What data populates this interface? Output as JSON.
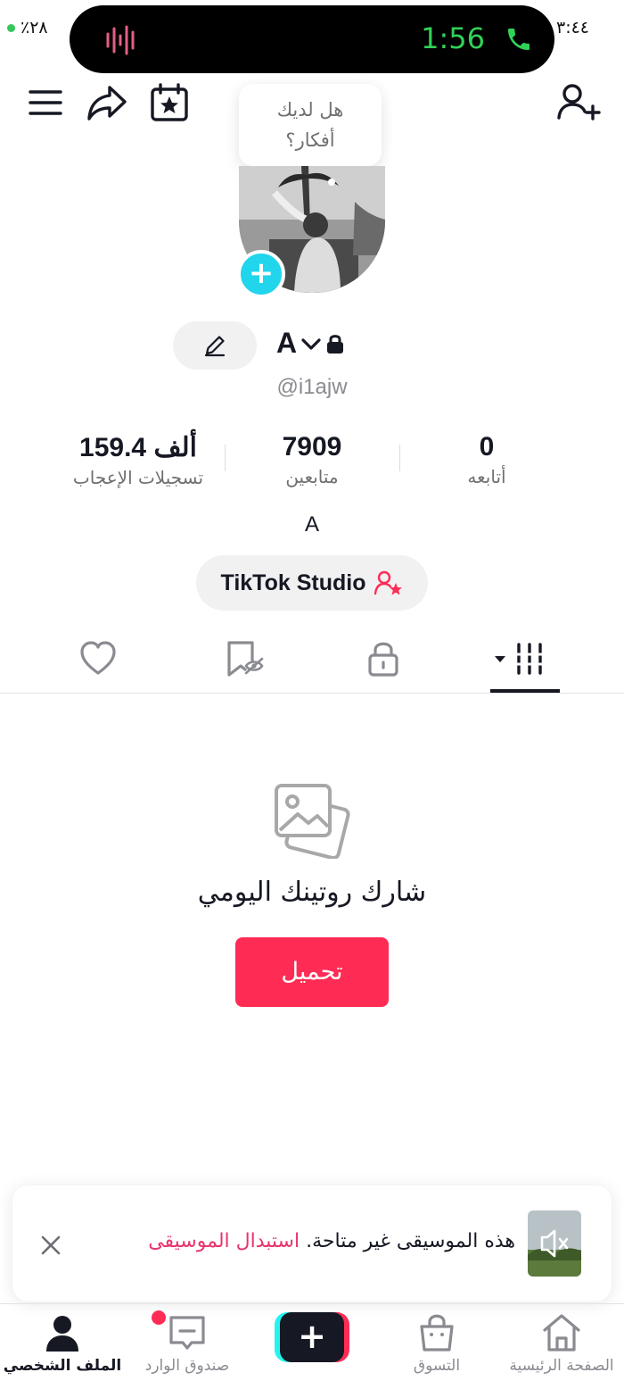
{
  "status_bar": {
    "battery": "٪٢٨",
    "time": "٣:٤٤"
  },
  "dynamic_island": {
    "call_timer": "1:56"
  },
  "tooltip": {
    "line1": "هل لديك",
    "line2": "أفكار؟"
  },
  "profile": {
    "display_name": "A",
    "username": "@i1ajw",
    "bio": "A"
  },
  "stats": [
    {
      "value": "0",
      "label": "أتابعه"
    },
    {
      "value": "7909",
      "label": "متابعين"
    },
    {
      "value": "159.4 ألف",
      "label": "تسجيلات الإعجاب"
    }
  ],
  "studio_button": {
    "label": "TikTok Studio"
  },
  "tabs": [
    {
      "icon": "videos-grid-icon",
      "active": true
    },
    {
      "icon": "lock-icon",
      "active": false
    },
    {
      "icon": "saved-icon",
      "active": false
    },
    {
      "icon": "heart-icon",
      "active": false
    }
  ],
  "empty_state": {
    "title": "شارك روتينك اليومي",
    "button": "تحميل"
  },
  "toast": {
    "message": "هذه الموسيقى غير متاحة.",
    "link": "استبدال الموسيقى"
  },
  "bottom_nav": [
    {
      "label": "الصفحة الرئيسية",
      "icon": "home-icon"
    },
    {
      "label": "التسوق",
      "icon": "shopping-bag-icon"
    },
    {
      "label": "",
      "icon": "create-icon"
    },
    {
      "label": "صندوق الوارد",
      "icon": "inbox-icon"
    },
    {
      "label": "الملف الشخصي",
      "icon": "profile-icon",
      "active": true
    }
  ],
  "colors": {
    "accent": "#fe2c55",
    "cyan": "#25f4ee",
    "call_green": "#31d158",
    "link_pink": "#e8336b"
  }
}
